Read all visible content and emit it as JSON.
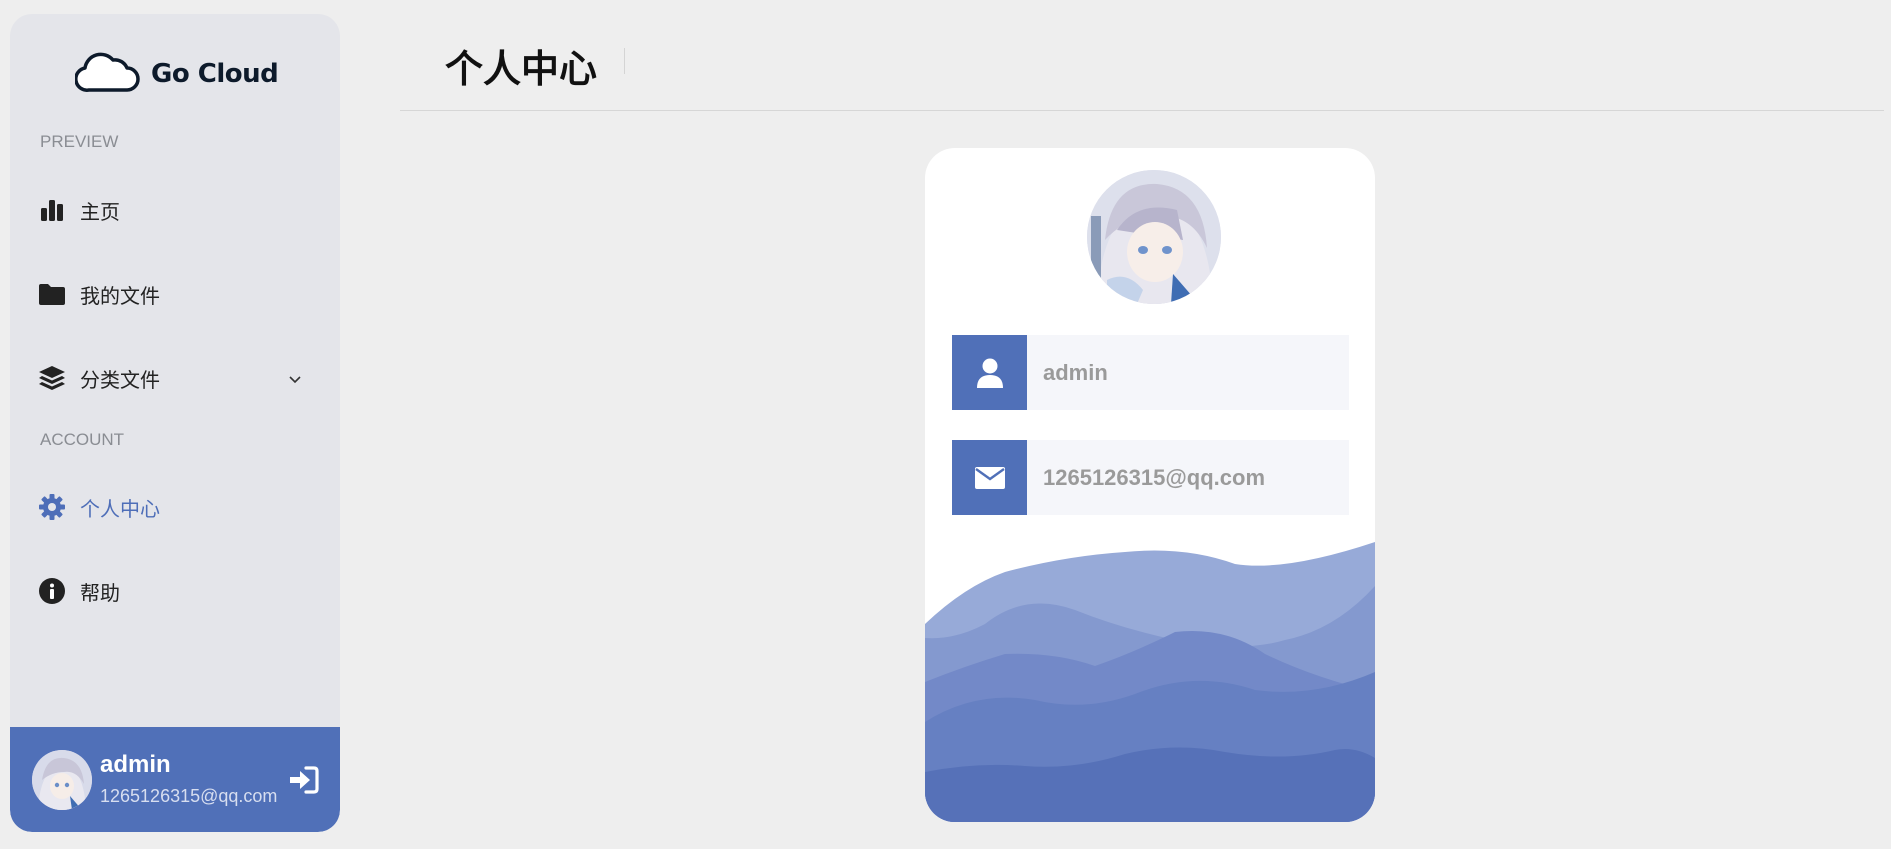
{
  "brand": {
    "name": "Go Cloud"
  },
  "sidebar": {
    "sections": [
      {
        "label": "PREVIEW"
      },
      {
        "label": "ACCOUNT"
      }
    ],
    "items": [
      {
        "label": "主页",
        "icon": "bar-chart-icon"
      },
      {
        "label": "我的文件",
        "icon": "folder-icon"
      },
      {
        "label": "分类文件",
        "icon": "layers-icon",
        "expandable": true
      },
      {
        "label": "个人中心",
        "icon": "gear-icon",
        "active": true
      },
      {
        "label": "帮助",
        "icon": "info-icon"
      }
    ],
    "user": {
      "name": "admin",
      "email": "1265126315@qq.com"
    }
  },
  "header": {
    "title": "个人中心"
  },
  "profile": {
    "username": "admin",
    "email": "1265126315@qq.com"
  },
  "colors": {
    "accent": "#5070b8",
    "sidebar_bg": "#e4e5ea",
    "page_bg": "#eeeeee",
    "field_bg": "#f5f6fa"
  }
}
